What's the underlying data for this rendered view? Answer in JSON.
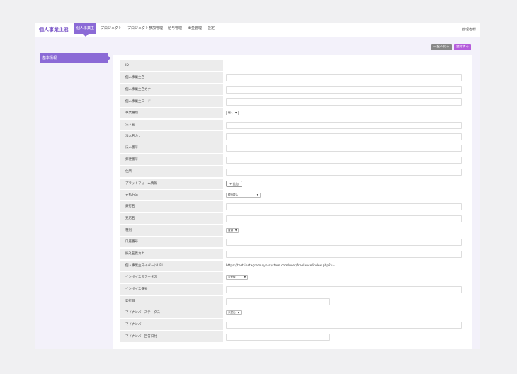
{
  "header": {
    "logo": "個人事業主君",
    "nav": [
      {
        "label": "個人事業主",
        "active": true
      },
      {
        "label": "プロジェクト"
      },
      {
        "label": "プロジェクト参加管理"
      },
      {
        "label": "給与管理"
      },
      {
        "label": "出金管理"
      },
      {
        "label": "設定"
      }
    ],
    "user": "管理者様"
  },
  "sidebar": {
    "items": [
      {
        "label": "基本情報",
        "active": true
      }
    ]
  },
  "toolbar": {
    "back_label": "一覧へ戻る",
    "save_label": "登録する"
  },
  "form": {
    "rows": [
      {
        "label": "ID",
        "type": "none"
      },
      {
        "label": "個人事業主名",
        "type": "input"
      },
      {
        "label": "個人事業主名カナ",
        "type": "input"
      },
      {
        "label": "個人事業主コード",
        "type": "input"
      },
      {
        "label": "事業種別",
        "type": "select",
        "value": "個人"
      },
      {
        "label": "法人名",
        "type": "input"
      },
      {
        "label": "法人名カナ",
        "type": "input"
      },
      {
        "label": "法人番号",
        "type": "input"
      },
      {
        "label": "郵便番号",
        "type": "input"
      },
      {
        "label": "住所",
        "type": "input"
      },
      {
        "label": "プラットフォーム情報",
        "type": "button",
        "value": "+ 追加"
      },
      {
        "label": "支払方法",
        "type": "select",
        "value": "銀行振込",
        "wide": true
      },
      {
        "label": "銀行名",
        "type": "input"
      },
      {
        "label": "支店名",
        "type": "input"
      },
      {
        "label": "種別",
        "type": "select",
        "value": "普通"
      },
      {
        "label": "口座番号",
        "type": "input"
      },
      {
        "label": "振込名義カナ",
        "type": "input"
      },
      {
        "label": "個人事業主マイページURL",
        "type": "text",
        "value": "https://test-instagram.cyo-system.com/user/freelance/index.php?u="
      },
      {
        "label": "インボイスステータス",
        "type": "select",
        "value": "未登録",
        "wide2": true
      },
      {
        "label": "インボイス番号",
        "type": "input"
      },
      {
        "label": "発行日",
        "type": "input",
        "short": true
      },
      {
        "label": "マイナンバーステータス",
        "type": "select",
        "value": "未提出"
      },
      {
        "label": "マイナンバー",
        "type": "input"
      },
      {
        "label": "マイナンバー回答日付",
        "type": "input",
        "short": true
      }
    ]
  }
}
